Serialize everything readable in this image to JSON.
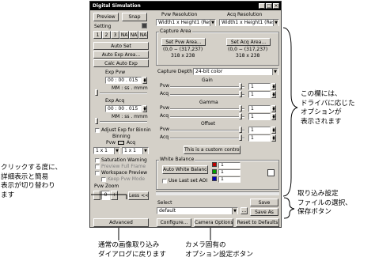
{
  "window": {
    "title": "Digital Simulation",
    "ctrl": [
      "_",
      "□",
      "×"
    ]
  },
  "left": {
    "preview_label": "Preview",
    "snap_label": "Snap",
    "setting_label": "Setting",
    "setting_tabs": [
      "1",
      "2",
      "3",
      "NA",
      "NA",
      "NA"
    ],
    "auto_set": "Auto Set",
    "auto_exp_area": "Auto Exp Area...",
    "calc_auto_exp": "Calc Auto Exp",
    "exp_pvw_label": "Exp Pvw",
    "exp_pvw_value": "00 : 00 . 015",
    "exp_pvw_format": "MM : ss . mmm",
    "exp_acq_label": "Exp Acq",
    "exp_acq_value": "00 : 00 . 015",
    "exp_acq_format": "MM : ss . mmm",
    "adjust_binning": "Adjust Exp for Binnin",
    "binning_label": "Binning",
    "binning_pvw": "Pvw",
    "binning_acq": "Acq",
    "bin_pvw_value": "1 x 1",
    "bin_acq_value": "1 x 1",
    "saturation_warning": "Saturation Warning",
    "preview_full_frame": "Preview Full Frame",
    "workspace_preview": "Workspace Preview",
    "keep_pvw_mode": "Keep Pvw Mode",
    "pvw_zoom_label": "Pvw Zoom",
    "zoom_minus": "−",
    "zoom_value": "0",
    "zoom_plus": "+",
    "less_label": "Less <<",
    "advanced_label": "Advanced"
  },
  "right": {
    "pvw_res_label": "Pvw Resolution",
    "acq_res_label": "Acq Resolution",
    "pvw_res_value": "Width1 x Height1 (Res",
    "acq_res_value": "Width1 x Height1 (Res",
    "capture_area_title": "Capture Area",
    "set_pvw_area": "Set Pvw Area...",
    "set_acq_area": "Set Acq Area...",
    "pvw_coords": "(0,0 − (317,237)",
    "pvw_size": "318 x 238",
    "acq_coords": "(0,0 − (317,237)",
    "acq_size": "318 x 238",
    "capture_depth_label": "Capture Depth",
    "capture_depth_value": "24-bit color",
    "gain_label": "Gain",
    "gamma_label": "Gamma",
    "offset_label": "Offset",
    "pvw_label": "Pvw",
    "acq_label": "Acq",
    "values": {
      "gain_pvw": "1",
      "gain_acq": "1",
      "gamma_pvw": "1",
      "gamma_acq": "1",
      "offset_pvw": "1",
      "offset_acq": "1"
    },
    "custom_control": "This is a custom control",
    "wb_title": "White Balance",
    "auto_wb": "Auto White Balance",
    "use_last_aoi": "Use Last set AOI",
    "wb_values": [
      "1",
      "1",
      "1"
    ]
  },
  "bottom": {
    "select_label": "Select",
    "select_value": "default",
    "ellipsis": "...",
    "save_label": "Save",
    "save_as_label": "Save As",
    "configure_label": "Configure...",
    "camera_options_label": "Camera Options...",
    "reset_defaults_label": "Reset to Defaults"
  },
  "annotations": {
    "right_options": [
      "この欄には、",
      "ドライバに応じた",
      "オプションが",
      "表示されます"
    ],
    "left_toggle": [
      "クリックする度に、",
      "詳細表示と簡易",
      "表示が切り替わり",
      "ます"
    ],
    "right_save": [
      "取り込み設定",
      "ファイルの選択、",
      "保存ボタン"
    ],
    "bottom_dialog": [
      "通常の画像取り込み",
      "ダイアログに戻ります"
    ],
    "bottom_camera": [
      "カメラ固有の",
      "オプション設定ボタン"
    ]
  }
}
